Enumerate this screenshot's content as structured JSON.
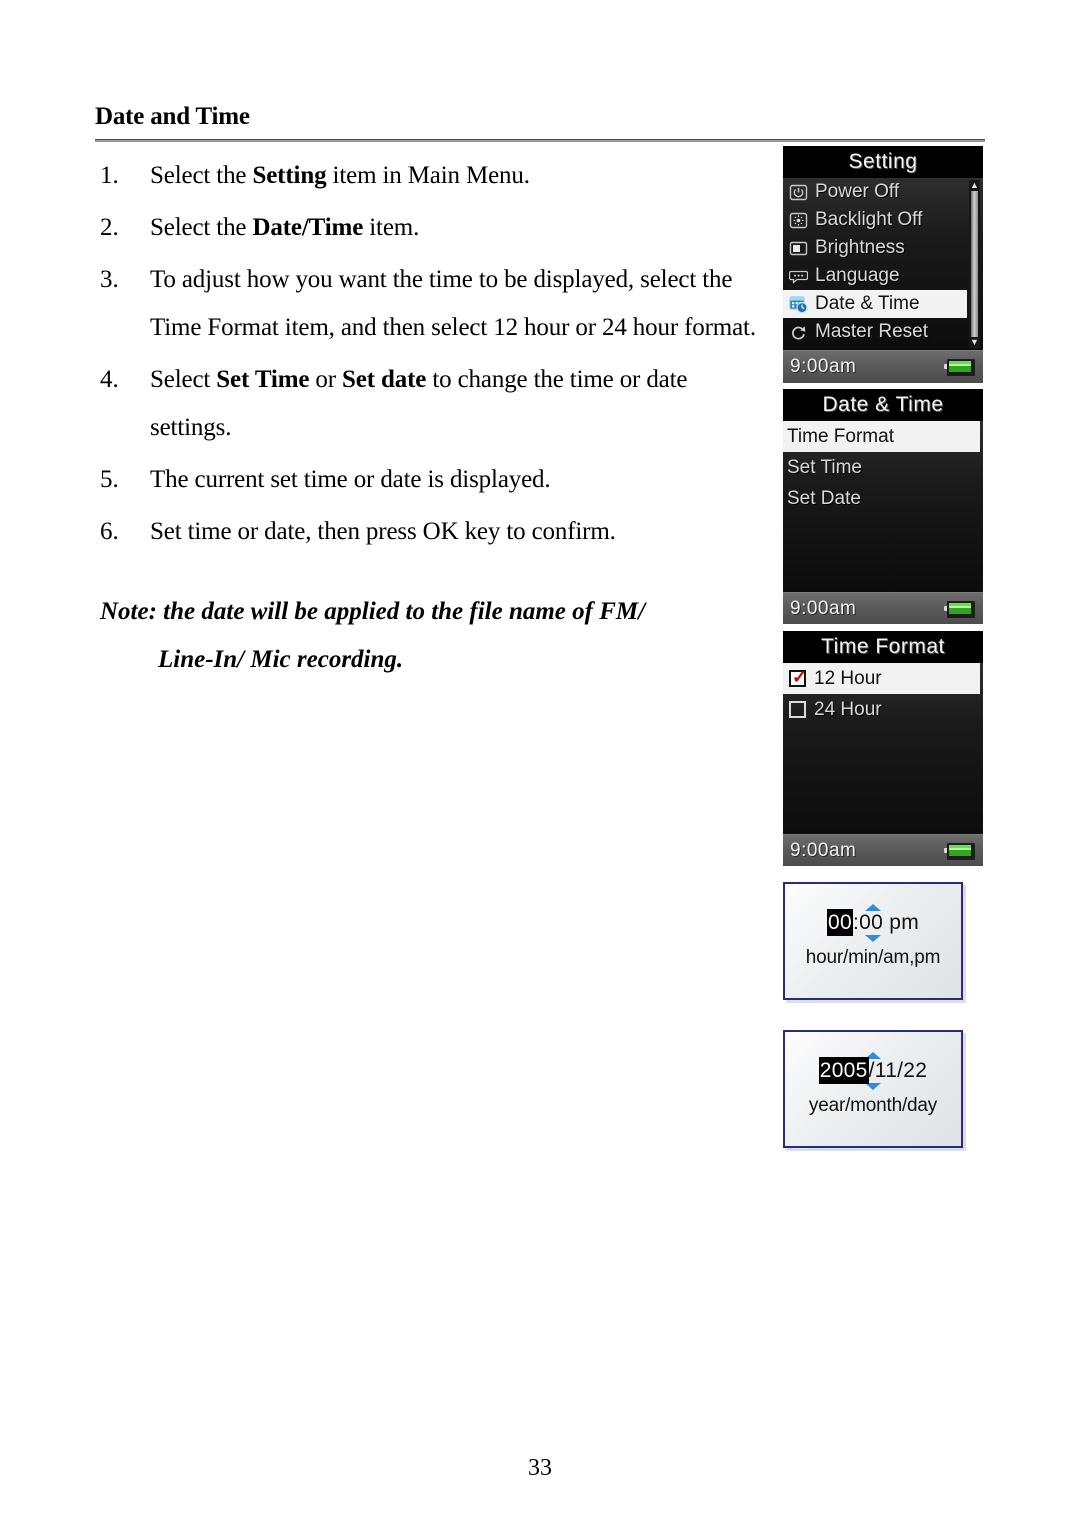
{
  "document": {
    "heading": "Date and Time",
    "page_number": "33",
    "steps": [
      {
        "num": "1.",
        "parts": [
          {
            "t": "Select the ",
            "b": false
          },
          {
            "t": "Setting",
            "b": true
          },
          {
            "t": " item in Main Menu.",
            "b": false
          }
        ]
      },
      {
        "num": "2.",
        "parts": [
          {
            "t": "Select the ",
            "b": false
          },
          {
            "t": "Date/Time",
            "b": true
          },
          {
            "t": " item.",
            "b": false
          }
        ]
      },
      {
        "num": "3.",
        "parts": [
          {
            "t": "To adjust how you want the time to be displayed, select the Time Format item, and then select 12 hour or 24 hour format.",
            "b": false
          }
        ]
      },
      {
        "num": "4.",
        "parts": [
          {
            "t": "Select ",
            "b": false
          },
          {
            "t": "Set Time",
            "b": true
          },
          {
            "t": " or ",
            "b": false
          },
          {
            "t": "Set date",
            "b": true
          },
          {
            "t": " to change the time or date settings.",
            "b": false
          }
        ]
      },
      {
        "num": "5.",
        "parts": [
          {
            "t": "The current set time or date is displayed.",
            "b": false
          }
        ]
      },
      {
        "num": "6.",
        "parts": [
          {
            "t": "Set time or date, then press OK key to confirm.",
            "b": false
          }
        ]
      }
    ],
    "note_line1": "Note: the date will be applied to the file name of FM/",
    "note_line2": "Line-In/ Mic recording."
  },
  "screens": [
    {
      "id": "setting",
      "title": "Setting",
      "status_time": "9:00am",
      "battery": "battery-icon",
      "scrollbar": true,
      "items": [
        {
          "label": "Power Off",
          "icon": "power-icon",
          "selected": false
        },
        {
          "label": "Backlight Off",
          "icon": "backlight-icon",
          "selected": false
        },
        {
          "label": "Brightness",
          "icon": "brightness-icon",
          "selected": false
        },
        {
          "label": "Language",
          "icon": "language-icon",
          "selected": false
        },
        {
          "label": "Date & Time",
          "icon": "date-time-icon",
          "selected": true
        },
        {
          "label": "Master Reset",
          "icon": "master-reset-icon",
          "selected": false
        }
      ]
    },
    {
      "id": "date-time",
      "title": "Date & Time",
      "status_time": "9:00am",
      "battery": "battery-icon",
      "scrollbar": false,
      "items": [
        {
          "label": "Time Format",
          "selected": true
        },
        {
          "label": "Set Time",
          "selected": false
        },
        {
          "label": "Set Date",
          "selected": false
        }
      ]
    },
    {
      "id": "time-format",
      "title": "Time Format",
      "status_time": "9:00am",
      "battery": "battery-icon",
      "scrollbar": false,
      "items": [
        {
          "label": "12 Hour",
          "selected": true,
          "checked": true
        },
        {
          "label": "24 Hour",
          "selected": false,
          "checked": false
        }
      ]
    }
  ],
  "dialogs": [
    {
      "id": "set-time",
      "highlight": "00",
      "rest": ":00 pm",
      "caption": "hour/min/am,pm",
      "arrow_up": "up-arrow-icon",
      "arrow_down": "down-arrow-icon"
    },
    {
      "id": "set-date",
      "highlight": "2005",
      "rest": "/11/22",
      "caption": "year/month/day",
      "arrow_up": "up-arrow-icon",
      "arrow_down": "down-arrow-icon"
    }
  ],
  "colors": {
    "accent_blue": "#2f8fd6",
    "dialog_border": "#2b2b7a",
    "check_red": "#d40000",
    "battery_green": "#2fa81e",
    "screen_bg": "#101010"
  }
}
